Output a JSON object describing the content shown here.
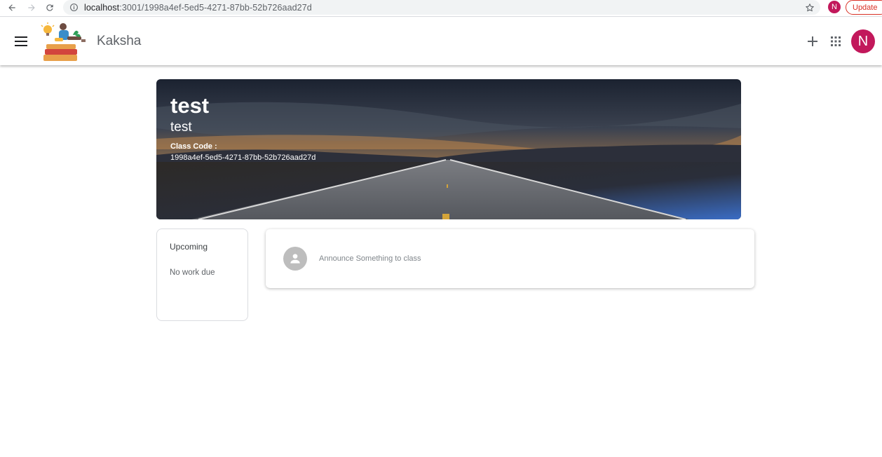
{
  "browser": {
    "url_host": "localhost",
    "url_path": ":3001/1998a4ef-5ed5-4271-87bb-52b726aad27d",
    "profile_initial": "N",
    "update_label": "Update",
    "icons": {
      "back": "arrow-left-icon",
      "forward": "arrow-right-icon",
      "reload": "reload-icon",
      "info": "info-icon",
      "bookmark": "star-icon"
    }
  },
  "header": {
    "app_title": "Kaksha",
    "avatar_initial": "N",
    "icons": {
      "menu": "hamburger-menu-icon",
      "add": "plus-icon",
      "apps": "apps-grid-icon"
    }
  },
  "banner": {
    "class_name": "test",
    "section": "test",
    "class_code_label": "Class Code :",
    "class_code": "1998a4ef-5ed5-4271-87bb-52b726aad27d"
  },
  "upcoming": {
    "title": "Upcoming",
    "empty_text": "No work due"
  },
  "stream": {
    "announce_prompt": "Announce Something to class"
  },
  "colors": {
    "avatar": "#c2185b",
    "update_red": "#d93025",
    "text_secondary": "#5f6368"
  }
}
